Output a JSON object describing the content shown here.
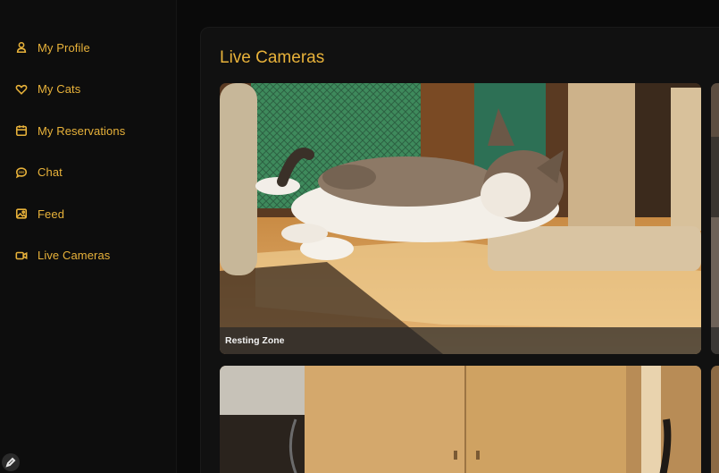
{
  "theme": {
    "accent": "#e8b23a"
  },
  "sidebar": {
    "items": [
      {
        "label": "My Profile",
        "icon": "user-icon"
      },
      {
        "label": "My Cats",
        "icon": "heart-icon"
      },
      {
        "label": "My Reservations",
        "icon": "calendar-icon"
      },
      {
        "label": "Chat",
        "icon": "chat-bubble-icon"
      },
      {
        "label": "Feed",
        "icon": "image-icon"
      },
      {
        "label": "Live Cameras",
        "icon": "video-camera-icon"
      }
    ]
  },
  "main": {
    "title": "Live Cameras",
    "cameras": [
      {
        "label": "Resting Zone"
      },
      {
        "label": ""
      },
      {
        "label": ""
      },
      {
        "label": ""
      }
    ]
  }
}
